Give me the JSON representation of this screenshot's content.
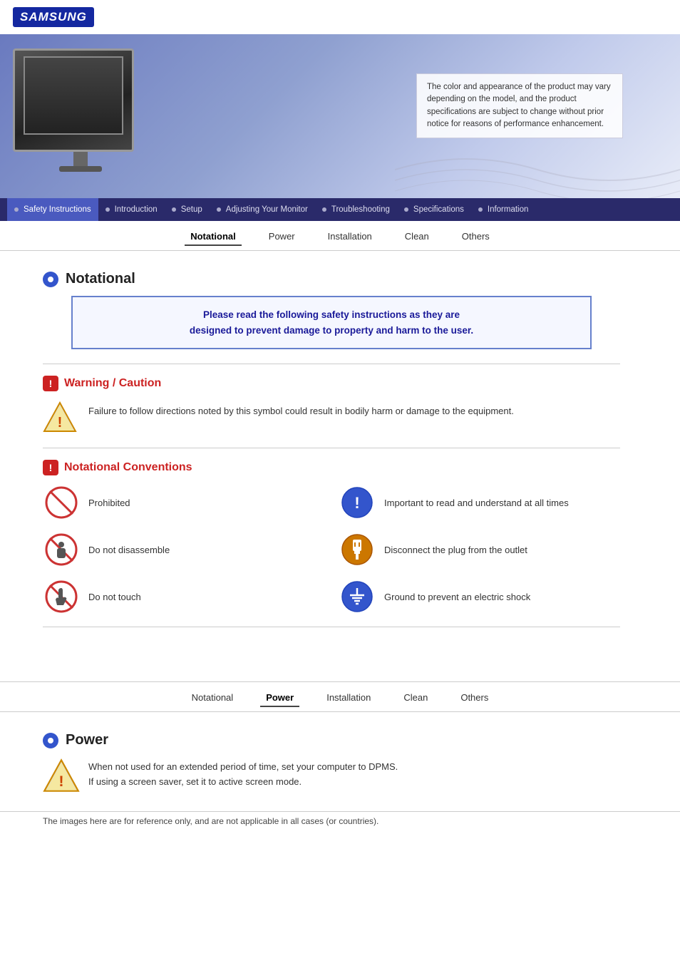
{
  "brand": "SAMSUNG",
  "hero": {
    "text": "The color and appearance of the product may vary depending on the model, and the product specifications are subject to change without prior notice for reasons of performance enhancement."
  },
  "nav": {
    "items": [
      {
        "label": "Safety Instructions",
        "active": true
      },
      {
        "label": "Introduction",
        "active": false
      },
      {
        "label": "Setup",
        "active": false
      },
      {
        "label": "Adjusting Your Monitor",
        "active": false
      },
      {
        "label": "Troubleshooting",
        "active": false
      },
      {
        "label": "Specifications",
        "active": false
      },
      {
        "label": "Information",
        "active": false
      }
    ]
  },
  "tabs_top": {
    "items": [
      {
        "label": "Notational",
        "active": true
      },
      {
        "label": "Power",
        "active": false
      },
      {
        "label": "Installation",
        "active": false
      },
      {
        "label": "Clean",
        "active": false
      },
      {
        "label": "Others",
        "active": false
      }
    ]
  },
  "notational": {
    "heading": "Notational",
    "safety_notice_line1": "Please read the following safety instructions as they are",
    "safety_notice_line2": "designed to prevent damage to property and harm to the user.",
    "warning_heading": "Warning / Caution",
    "warning_text": "Failure to follow directions noted by this symbol could result in bodily harm or damage to the equipment.",
    "conventions_heading": "Notational Conventions",
    "conventions": [
      {
        "icon": "prohibited",
        "label": "Prohibited"
      },
      {
        "icon": "important",
        "label": "Important to read and understand at all times"
      },
      {
        "icon": "disassemble",
        "label": "Do not disassemble"
      },
      {
        "icon": "disconnect",
        "label": "Disconnect the plug from the outlet"
      },
      {
        "icon": "notouch",
        "label": "Do not touch"
      },
      {
        "icon": "ground",
        "label": "Ground to prevent an electric shock"
      }
    ]
  },
  "tabs_bottom": {
    "items": [
      {
        "label": "Notational",
        "active": false
      },
      {
        "label": "Power",
        "active": true
      },
      {
        "label": "Installation",
        "active": false
      },
      {
        "label": "Clean",
        "active": false
      },
      {
        "label": "Others",
        "active": false
      }
    ]
  },
  "power": {
    "heading": "Power",
    "text_line1": "When not used for an extended period of time, set your computer to DPMS.",
    "text_line2": "If using a screen saver, set it to active screen mode."
  },
  "footer": {
    "note": "The images here are for reference only, and are not applicable in all cases (or countries)."
  }
}
